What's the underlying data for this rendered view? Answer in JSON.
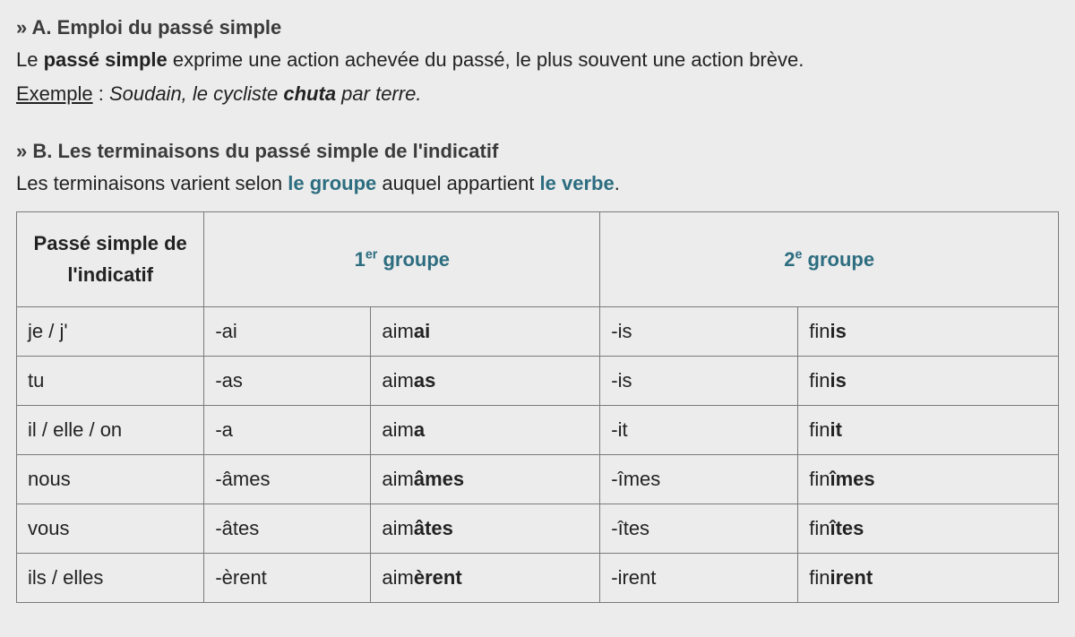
{
  "sectionA": {
    "title": "» A. Emploi du passé simple",
    "line_pre": "Le ",
    "line_bold": "passé simple",
    "line_post": " exprime une action achevée du passé, le plus souvent une action brève.",
    "example_label": "Exemple",
    "example_sep": " : ",
    "example_pre": "Soudain, le cycliste ",
    "example_verb": "chuta",
    "example_post": " par terre."
  },
  "sectionB": {
    "title": "» B. Les terminaisons du passé simple de l'indicatif",
    "line_pre": "Les terminaisons varient selon ",
    "link1": "le groupe",
    "line_mid": " auquel appartient ",
    "link2": "le verbe",
    "line_post": "."
  },
  "table": {
    "headers": {
      "col0_line1": "Passé simple de",
      "col0_line2": "l'indicatif",
      "g1_num": "1",
      "g1_sup": "er",
      "g_word": " groupe",
      "g2_num": "2",
      "g2_sup": "e"
    },
    "rows": [
      {
        "pronoun": "je / j'",
        "e1": "-ai",
        "ex1_root": "aim",
        "ex1_end": "ai",
        "e2": "-is",
        "ex2_root": "fin",
        "ex2_end": "is"
      },
      {
        "pronoun": "tu",
        "e1": "-as",
        "ex1_root": "aim",
        "ex1_end": "as",
        "e2": "-is",
        "ex2_root": "fin",
        "ex2_end": "is"
      },
      {
        "pronoun": "il / elle / on",
        "e1": "-a",
        "ex1_root": "aim",
        "ex1_end": "a",
        "e2": "-it",
        "ex2_root": "fin",
        "ex2_end": "it"
      },
      {
        "pronoun": "nous",
        "e1": "-âmes",
        "ex1_root": "aim",
        "ex1_end": "âmes",
        "e2": "-îmes",
        "ex2_root": "fin",
        "ex2_end": "îmes"
      },
      {
        "pronoun": "vous",
        "e1": "-âtes",
        "ex1_root": "aim",
        "ex1_end": "âtes",
        "e2": "-îtes",
        "ex2_root": "fin",
        "ex2_end": "îtes"
      },
      {
        "pronoun": "ils / elles",
        "e1": "-èrent",
        "ex1_root": "aim",
        "ex1_end": "èrent",
        "e2": "-irent",
        "ex2_root": "fin",
        "ex2_end": "irent"
      }
    ]
  }
}
